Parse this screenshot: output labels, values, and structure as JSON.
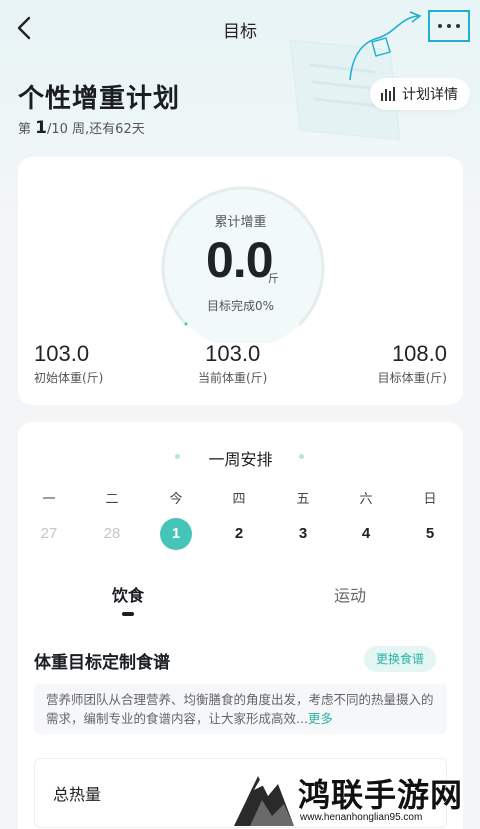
{
  "navbar": {
    "title": "目标"
  },
  "plan": {
    "title": "个性增重计划",
    "week_prefix": "第",
    "week_current": "1",
    "week_rest": "/10 周,还有62天",
    "detail_button": "计划详情"
  },
  "gauge": {
    "label": "累计增重",
    "value": "0.0",
    "unit": "斤",
    "progress_text": "目标完成0%",
    "progress": 0
  },
  "stats": [
    {
      "value": "103.0",
      "label": "初始体重(斤)"
    },
    {
      "value": "103.0",
      "label": "当前体重(斤)"
    },
    {
      "value": "108.0",
      "label": "目标体重(斤)"
    }
  ],
  "week": {
    "title": "一周安排",
    "weekdays": [
      "一",
      "二",
      "今",
      "四",
      "五",
      "六",
      "日"
    ],
    "dates": [
      "27",
      "28",
      "1",
      "2",
      "3",
      "4",
      "5"
    ]
  },
  "tabs": [
    "饮食",
    "运动"
  ],
  "recipe": {
    "title": "体重目标定制食谱",
    "swap_button": "更换食谱",
    "description": "营养师团队从合理营养、均衡膳食的角度出发，考虑不同的热量摄入的需求，编制专业的食谱内容，让大家形成高效...",
    "more_link": "更多",
    "kcal_label": "总热量"
  },
  "watermark": {
    "text": "鸿联手游网",
    "url": "www.henanhonglian95.com"
  },
  "colors": {
    "accent": "#45c4b8",
    "accent_light": "#e3f6f4",
    "highlight_border": "#1db0d0"
  }
}
